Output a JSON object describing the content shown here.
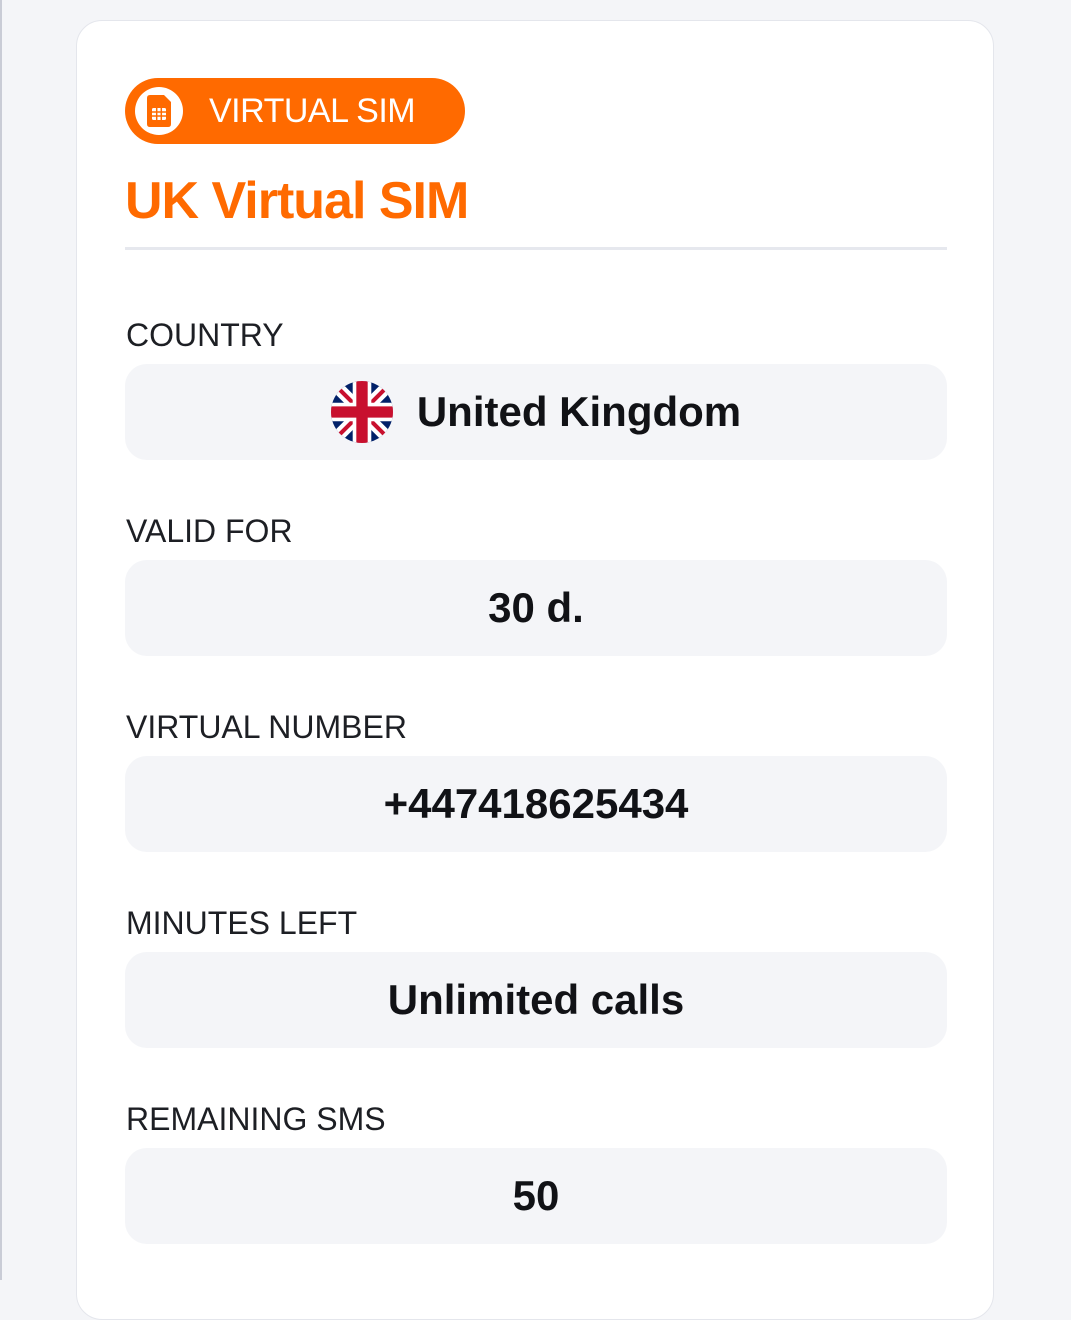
{
  "colors": {
    "accent": "#ff6a00",
    "page_background": "#f4f5f8",
    "card_background": "#ffffff",
    "field_background": "#f4f5f8",
    "text": "#111216"
  },
  "badge": {
    "label": "VIRTUAL SIM",
    "icon": "sim-card-icon"
  },
  "title": "UK Virtual SIM",
  "fields": [
    {
      "label": "COUNTRY",
      "value": "United Kingdom",
      "icon": "uk-flag-icon"
    },
    {
      "label": "VALID FOR",
      "value": "30 d."
    },
    {
      "label": "VIRTUAL NUMBER",
      "value": "+447418625434"
    },
    {
      "label": "MINUTES LEFT",
      "value": "Unlimited calls"
    },
    {
      "label": "REMAINING SMS",
      "value": "50"
    }
  ]
}
